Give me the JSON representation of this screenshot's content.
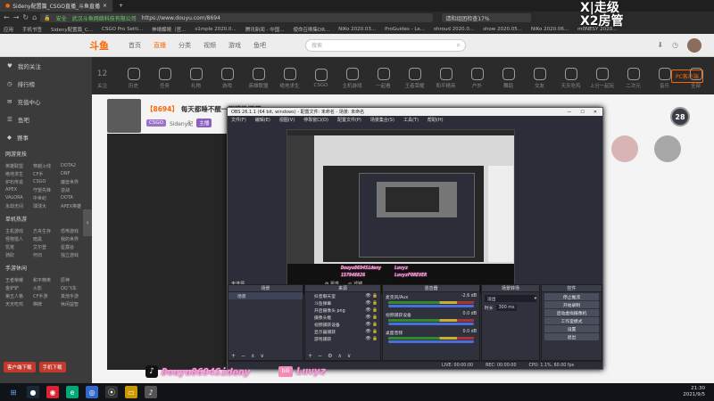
{
  "browser": {
    "tabs": [
      {
        "label": "Sideny配置篇_CSGO直播_斗鱼直播"
      },
      {
        "label": ""
      }
    ],
    "address": "https://www.douyu.com/8694",
    "security_text": "安全",
    "address_owner": "武汉斗鱼网络科技有限公司",
    "search_placeholder": "请和组团检查17%",
    "bookmarks": [
      "应用",
      "手机书签",
      "Sideny配置篇_C...",
      "CSGO Pro Setti...",
      "神晴蝶睛（官...",
      "s1mple 2020.0...",
      "腾讯新闻 - 中国...",
      "使命召唤集DR...",
      "NiKo 2020.03...",
      "ProGuides - Le...",
      "shroud 2020.0...",
      "show 2020.05...",
      "NiKo 2020.06...",
      "m0NESY 2020..."
    ]
  },
  "watermark": {
    "line1": "X|走级",
    "line2": "X2房管"
  },
  "site": {
    "logo": "斗鱼",
    "nav": [
      "首页",
      "直播",
      "分类",
      "视频",
      "游戏",
      "鱼吧"
    ],
    "nav_active_index": 1,
    "search_placeholder": "搜索",
    "right_badge": "PC客户端",
    "categories": [
      {
        "label": "关注",
        "count": "12"
      },
      {
        "label": "历史",
        "count": ""
      },
      {
        "label": "任务",
        "count": ""
      },
      {
        "label": "礼物",
        "count": ""
      },
      {
        "label": "游戏",
        "count": ""
      },
      {
        "label": "英雄联盟",
        "count": ""
      },
      {
        "label": "绝地求生",
        "count": ""
      },
      {
        "label": "CSGO",
        "count": ""
      },
      {
        "label": "主机游戏",
        "count": ""
      },
      {
        "label": "一起看",
        "count": ""
      },
      {
        "label": "王者荣耀",
        "count": ""
      },
      {
        "label": "和平精英",
        "count": ""
      },
      {
        "label": "户外",
        "count": ""
      },
      {
        "label": "舞蹈",
        "count": ""
      },
      {
        "label": "交友",
        "count": ""
      },
      {
        "label": "天天吃鸡",
        "count": ""
      },
      {
        "label": "上分一起玩",
        "count": ""
      },
      {
        "label": "二次元",
        "count": ""
      },
      {
        "label": "音乐",
        "count": ""
      },
      {
        "label": "全部",
        "count": ""
      }
    ]
  },
  "sidebar": {
    "items": [
      {
        "icon": "heart-icon",
        "label": "我的关注"
      },
      {
        "icon": "clock-icon",
        "label": "排行榜"
      },
      {
        "icon": "gift-icon",
        "label": "充值中心"
      },
      {
        "icon": "chat-icon",
        "label": "鱼吧"
      },
      {
        "icon": "gem-icon",
        "label": "赛事"
      }
    ],
    "sections": [
      {
        "title": "网游竞技",
        "items": [
          "英雄联盟",
          "穿越火线",
          "DOTA2",
          "绝地求生",
          "CF手",
          "DNF",
          "炉石传说",
          "CSGO",
          "魔兽世界",
          "APEX",
          "守望先锋",
          "逆战",
          "VALORA",
          "中世纪",
          "DOTA",
          "永劫无间",
          "球球大",
          "APEX英雄"
        ]
      },
      {
        "title": "单机热游",
        "items": [
          "主机游戏",
          "方舟生存",
          "恐怖游戏",
          "怪物猎人",
          "暗黑",
          "我的世界",
          "饥荒",
          "艾尔登",
          "星露谷",
          "骑砍",
          "怀旧",
          "独立游戏"
        ]
      },
      {
        "title": "手游休闲",
        "items": [
          "王者荣耀",
          "和平精英",
          "原神",
          "金铲铲",
          "火影",
          "QQ飞车",
          "第五人格",
          "CF手游",
          "其他手游",
          "天天吃鸡",
          "棋牌",
          "休闲益智"
        ]
      }
    ],
    "footer_buttons": [
      "客户端下载",
      "手机下载"
    ]
  },
  "streamer": {
    "room_id": "【8694】",
    "title": "每天都睡不醒一眼睛睁不开",
    "name": "Sideny配",
    "tag1": "CSGO",
    "tag2": "主播",
    "level": "28"
  },
  "obs": {
    "title": "OBS 26.1.1 (64 bit, windows) - 配置文件: 未命名 - 场景: 未命名",
    "menu": [
      "文件(F)",
      "编辑(E)",
      "视图(V)",
      "停靠窗口(D)",
      "配置文件(P)",
      "场景集合(S)",
      "工具(T)",
      "帮助(H)"
    ],
    "toolbar_left": "未选源",
    "toolbar_props": "属性",
    "toolbar_filter": "滤镜",
    "docks": {
      "scenes": {
        "title": "场景",
        "items": [
          "场景"
        ]
      },
      "sources": {
        "title": "来源",
        "items": [
          "抖音聊天室",
          "斗鱼弹幕",
          "开启摄像头 png",
          "摄像头框",
          "视频捕获设备",
          "显示器捕获",
          "游戏捕获"
        ]
      },
      "mixer": {
        "title": "混音器",
        "channels": [
          {
            "name": "麦克风/Aux",
            "db": "-2.6 dB"
          },
          {
            "name": "视频捕获设备",
            "db": "0.0 dB"
          },
          {
            "name": "桌面音频",
            "db": "0.0 dB"
          }
        ]
      },
      "transitions": {
        "title": "场景转场",
        "type": "淡出",
        "duration_label": "时长",
        "duration": "300 ms"
      },
      "controls": {
        "title": "控件",
        "buttons": [
          "停止推流",
          "开始录制",
          "启动虚拟摄像机",
          "工作室模式",
          "设置",
          "退出"
        ]
      }
    },
    "status": {
      "live": "LIVE: 00:00:00",
      "rec": "REC: 00:00:00",
      "cpu": "CPU: 1.1%, 60.00 fps"
    }
  },
  "overlay": {
    "tiktok_name": "Douyu8694Sideny",
    "tiktok_id": "157948826",
    "right_name": "Luvyz",
    "right_name2": "LuvyzFOREVER"
  },
  "taskbar": {
    "time": "21:30",
    "date": "2021/9/5"
  }
}
